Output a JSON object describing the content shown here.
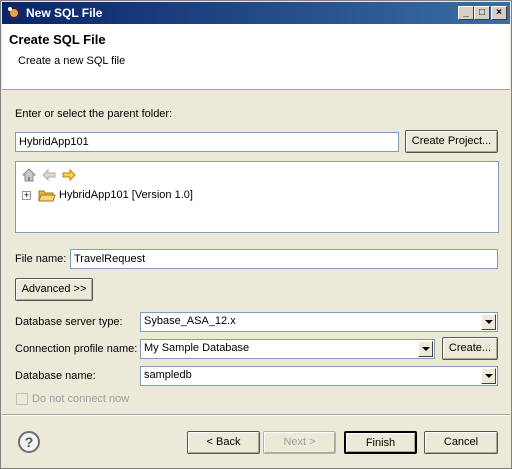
{
  "window": {
    "title": "New SQL File",
    "controls": {
      "minimize": "_",
      "maximize": "□",
      "close": "×"
    }
  },
  "header": {
    "title": "Create SQL File",
    "description": "Create a new SQL file"
  },
  "parent_folder": {
    "label": "Enter or select the parent folder:",
    "value": "HybridApp101",
    "create_project_label": "Create Project..."
  },
  "tree": {
    "toolbar_icons": [
      "home-icon",
      "back-arrow-icon",
      "forward-arrow-icon"
    ],
    "items": [
      {
        "label": "HybridApp101 [Version 1.0]",
        "icon": "folder-open-icon",
        "expanded": false
      }
    ]
  },
  "file_name": {
    "label": "File name:",
    "value": "TravelRequest"
  },
  "advanced_label": "Advanced >>",
  "db_server_type": {
    "label": "Database server type:",
    "value": "Sybase_ASA_12.x"
  },
  "connection_profile": {
    "label": "Connection profile name:",
    "value": "My Sample Database",
    "create_label": "Create..."
  },
  "db_name": {
    "label": "Database name:",
    "value": "sampledb"
  },
  "do_not_connect": {
    "label": "Do not connect now",
    "checked": false,
    "enabled": false
  },
  "footer": {
    "help_label": "?",
    "back_label": "< Back",
    "next_label": "Next >",
    "finish_label": "Finish",
    "cancel_label": "Cancel"
  }
}
